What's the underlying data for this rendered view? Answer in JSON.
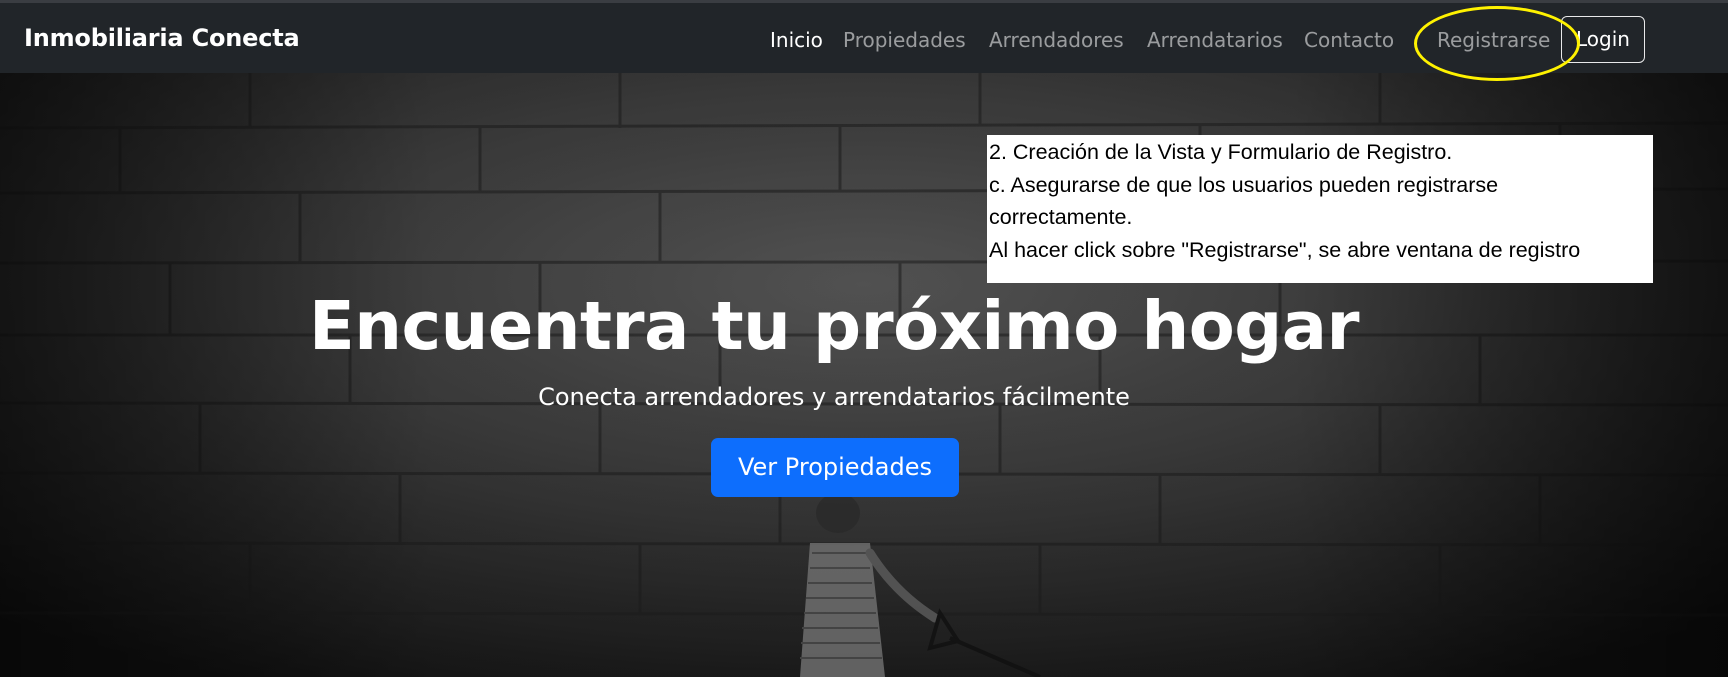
{
  "navbar": {
    "brand": "Inmobiliaria Conecta",
    "links": [
      {
        "label": "Inicio",
        "active": true
      },
      {
        "label": "Propiedades",
        "active": false
      },
      {
        "label": "Arrendadores",
        "active": false
      },
      {
        "label": "Arrendatarios",
        "active": false
      },
      {
        "label": "Contacto",
        "active": false
      },
      {
        "label": "Registrarse",
        "active": false
      }
    ],
    "login_label": "Login",
    "highlight_color": "#fff200"
  },
  "hero": {
    "title": "Encuentra tu próximo hogar",
    "subtitle": "Conecta arrendadores y arrendatarios fácilmente",
    "cta_label": "Ver Propiedades",
    "cta_color": "#0d6efd"
  },
  "note": {
    "lines": [
      "2. Creación de la Vista y Formulario de Registro.",
      "c. Asegurarse de que los usuarios pueden registrarse",
      "correctamente.",
      "Al hacer click sobre \"Registrarse\", se abre ventana de registro"
    ]
  },
  "colors": {
    "navbar_bg": "#212529",
    "link_muted": "rgba(255,255,255,0.55)",
    "text": "#ffffff"
  }
}
